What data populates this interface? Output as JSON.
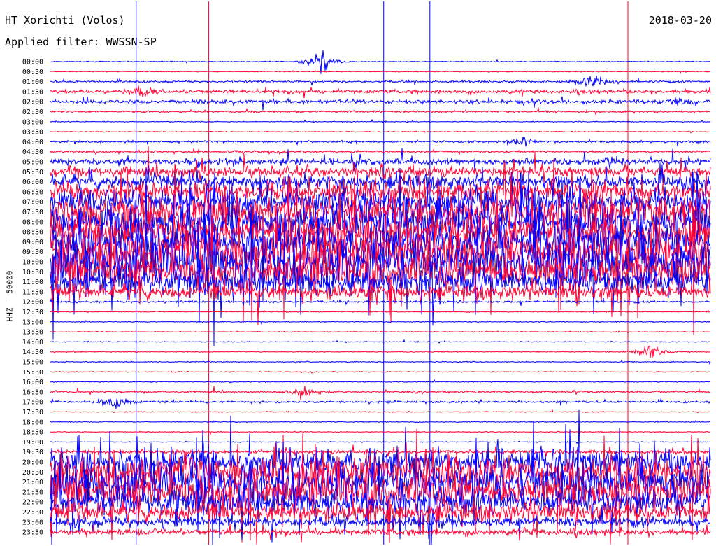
{
  "header": {
    "station": "HT Xorichti (Volos)",
    "filter": "Applied filter: WWSSN-SP",
    "date": "2018-03-20"
  },
  "chart_data": {
    "type": "line",
    "title": "HT Xorichti (Volos)",
    "subtitle": "Applied filter: WWSSN-SP",
    "date": "2018-03-20",
    "ylabel": "HHZ - 50000",
    "xlabel": "",
    "grid": false,
    "y_tick_labels": [
      "00:00",
      "00:30",
      "01:00",
      "01:30",
      "02:00",
      "02:30",
      "03:00",
      "03:30",
      "04:00",
      "04:30",
      "05:00",
      "05:30",
      "06:00",
      "06:30",
      "07:00",
      "07:30",
      "08:00",
      "08:30",
      "09:00",
      "09:30",
      "10:00",
      "10:30",
      "11:00",
      "11:30",
      "12:00",
      "12:30",
      "13:00",
      "13:30",
      "14:00",
      "14:30",
      "15:00",
      "15:30",
      "16:00",
      "16:30",
      "17:00",
      "17:30",
      "18:00",
      "18:30",
      "19:00",
      "19:30",
      "20:00",
      "20:30",
      "21:00",
      "21:30",
      "22:00",
      "22:30",
      "23:00",
      "23:30"
    ],
    "trace_colors": [
      "#0000ff",
      "#ff0033"
    ],
    "activity_levels": [
      1,
      1,
      2,
      3,
      3,
      2,
      1,
      1,
      2,
      2,
      4,
      5,
      6,
      7,
      8,
      9,
      9,
      9,
      9,
      10,
      10,
      9,
      8,
      6,
      2,
      1,
      1,
      1,
      1,
      1,
      1,
      1,
      1,
      2,
      2,
      1,
      1,
      1,
      1,
      3,
      8,
      9,
      9,
      9,
      8,
      7,
      5,
      4
    ],
    "events": [
      {
        "time": "00:00",
        "x": 0.41,
        "amp": 9
      },
      {
        "time": "01:00",
        "x": 0.82,
        "amp": 6
      },
      {
        "time": "01:30",
        "x": 0.14,
        "amp": 5
      },
      {
        "time": "02:00",
        "x": 0.95,
        "amp": 4
      },
      {
        "time": "04:00",
        "x": 0.72,
        "amp": 4
      },
      {
        "time": "05:00",
        "x": 0.85,
        "amp": 4
      },
      {
        "time": "14:30",
        "x": 0.91,
        "amp": 6
      },
      {
        "time": "16:30",
        "x": 0.38,
        "amp": 4
      },
      {
        "time": "17:00",
        "x": 0.1,
        "amp": 7
      }
    ],
    "spikes": [
      {
        "x": 0.13,
        "color": "#0000ff"
      },
      {
        "x": 0.505,
        "color": "#0000ff"
      },
      {
        "x": 0.575,
        "color": "#0000ff"
      },
      {
        "x": 0.24,
        "color": "#ff0033"
      },
      {
        "x": 0.875,
        "color": "#ff0033"
      }
    ]
  }
}
